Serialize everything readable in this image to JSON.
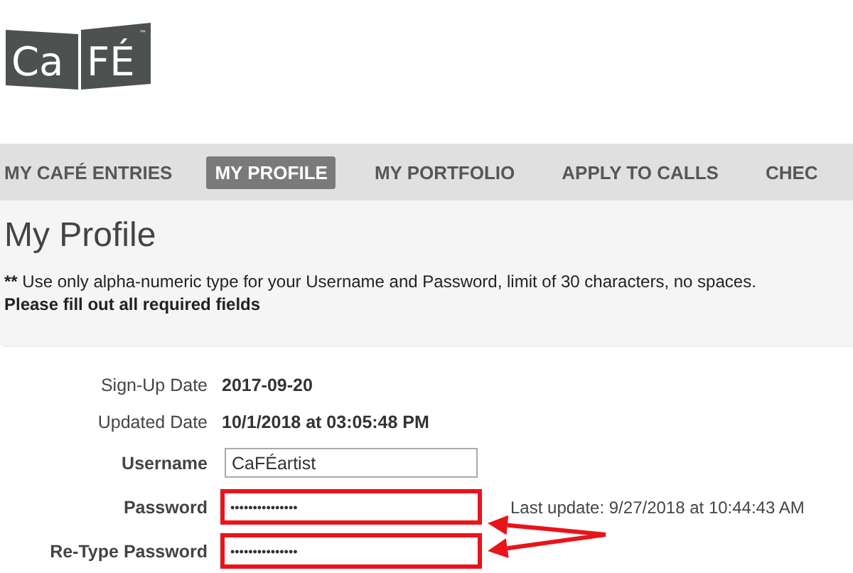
{
  "logo": {
    "left": "Ca",
    "right": "FÉ",
    "mark": "™"
  },
  "nav": [
    {
      "label": "MY CAFÉ ENTRIES",
      "selected": false
    },
    {
      "label": "MY PROFILE",
      "selected": true
    },
    {
      "label": "MY PORTFOLIO",
      "selected": false
    },
    {
      "label": "APPLY TO CALLS",
      "selected": false
    },
    {
      "label": "CHEC",
      "selected": false
    }
  ],
  "page_title": "My Profile",
  "notes": [
    {
      "prefix": "**",
      "text": " Use only alpha-numeric type for your Username and Password, limit of 30 characters, no spaces."
    },
    {
      "text": "Please fill out all required fields",
      "bold": true
    }
  ],
  "form": [
    {
      "kind": "info",
      "label": "Sign-Up Date",
      "value": "2017-09-20"
    },
    {
      "kind": "info",
      "label": "Updated Date",
      "value": "10/1/2018 at 03:05:48 PM"
    },
    {
      "kind": "text",
      "label": "Username",
      "value": "CaFÉartist",
      "highlighted": false
    },
    {
      "kind": "password",
      "label": "Password",
      "value": "•••••••••••••••",
      "highlighted": true,
      "note": "Last update: 9/27/2018 at 10:44:43 AM"
    },
    {
      "kind": "password",
      "label": "Re-Type Password",
      "value": "•••••••••••••••",
      "highlighted": true
    }
  ]
}
